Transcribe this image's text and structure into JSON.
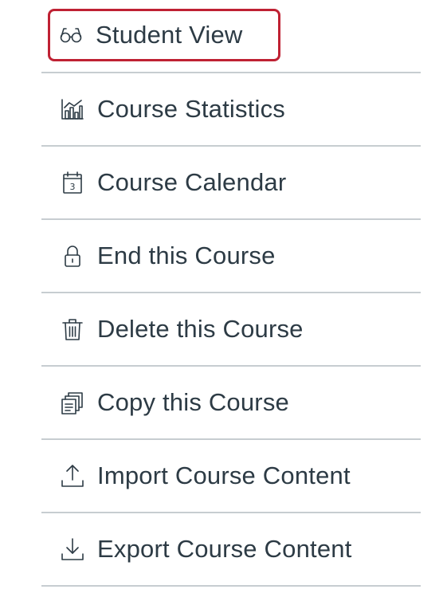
{
  "menu": {
    "items": [
      {
        "label": "Student View",
        "icon": "glasses-icon",
        "highlighted": true
      },
      {
        "label": "Course Statistics",
        "icon": "bar-chart-icon"
      },
      {
        "label": "Course Calendar",
        "icon": "calendar-icon",
        "icon_text": "3"
      },
      {
        "label": "End this Course",
        "icon": "lock-icon"
      },
      {
        "label": "Delete this Course",
        "icon": "trash-icon"
      },
      {
        "label": "Copy this Course",
        "icon": "copy-icon"
      },
      {
        "label": "Import Course Content",
        "icon": "upload-icon"
      },
      {
        "label": "Export Course Content",
        "icon": "download-icon"
      }
    ]
  },
  "colors": {
    "text": "#2d3b45",
    "divider": "#c7cdd1",
    "highlight_border": "#bf2133"
  }
}
